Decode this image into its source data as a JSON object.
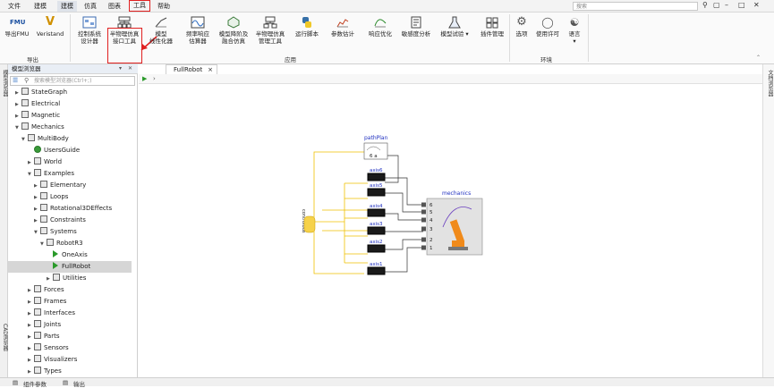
{
  "menubar": {
    "items": [
      "文件",
      "建模",
      "建模",
      "仿真",
      "图表",
      "工具",
      "帮助"
    ],
    "search_placeholder": "搜索"
  },
  "ribbon": {
    "export_fmu": "导出FMU",
    "veristand": "Veristand",
    "export_group": "导出",
    "ctrl_design": [
      "控制系统",
      "设计器"
    ],
    "hil_interface": [
      "半物理仿真",
      "接口工具"
    ],
    "model_linearizer": [
      "模型",
      "线性化器"
    ],
    "freq_estimator": [
      "频率响应",
      "估算器"
    ],
    "model_reduction": [
      "模型降阶及",
      "融合仿真"
    ],
    "hil_manager": [
      "半物理仿真",
      "管理工具"
    ],
    "run_script": "运行脚本",
    "param_estimation": "参数估计",
    "response_opt": "响应优化",
    "sensitivity": "敏感度分析",
    "model_test": "模型试验",
    "plugin_manager": "插件管理",
    "app_group": "应用",
    "options": "选项",
    "license": "使用许可",
    "language": "语言",
    "env_group": "环境"
  },
  "browser": {
    "title": "模型浏览器",
    "search_placeholder": "搜索模型浏览器(Ctrl+;)",
    "tree": [
      {
        "label": "StateGraph",
        "level": 1,
        "icon": "box"
      },
      {
        "label": "Electrical",
        "level": 1,
        "icon": "box"
      },
      {
        "label": "Magnetic",
        "level": 1,
        "icon": "box"
      },
      {
        "label": "Mechanics",
        "level": 1,
        "icon": "box",
        "open": true
      },
      {
        "label": "MultiBody",
        "level": 2,
        "icon": "box",
        "open": true
      },
      {
        "label": "UsersGuide",
        "level": 3,
        "icon": "green"
      },
      {
        "label": "World",
        "level": 3,
        "icon": "box"
      },
      {
        "label": "Examples",
        "level": 3,
        "icon": "box",
        "open": true
      },
      {
        "label": "Elementary",
        "level": 4,
        "icon": "box"
      },
      {
        "label": "Loops",
        "level": 4,
        "icon": "box"
      },
      {
        "label": "Rotational3DEffects",
        "level": 4,
        "icon": "box"
      },
      {
        "label": "Constraints",
        "level": 4,
        "icon": "box"
      },
      {
        "label": "Systems",
        "level": 4,
        "icon": "box",
        "open": true
      },
      {
        "label": "RobotR3",
        "level": 5,
        "icon": "box",
        "open": true
      },
      {
        "label": "OneAxis",
        "level": 6,
        "icon": "play"
      },
      {
        "label": "FullRobot",
        "level": 6,
        "icon": "play",
        "selected": true
      },
      {
        "label": "Utilities",
        "level": 6,
        "icon": "box"
      },
      {
        "label": "Forces",
        "level": 3,
        "icon": "box"
      },
      {
        "label": "Frames",
        "level": 3,
        "icon": "box"
      },
      {
        "label": "Interfaces",
        "level": 3,
        "icon": "box"
      },
      {
        "label": "Joints",
        "level": 3,
        "icon": "box"
      },
      {
        "label": "Parts",
        "level": 3,
        "icon": "box"
      },
      {
        "label": "Sensors",
        "level": 3,
        "icon": "box"
      },
      {
        "label": "Visualizers",
        "level": 3,
        "icon": "box"
      },
      {
        "label": "Types",
        "level": 3,
        "icon": "box"
      }
    ]
  },
  "left_strip": {
    "model_browser": "模型浏览器",
    "cad_browser": "CAD浏览器"
  },
  "right_strip": {
    "doc_browser": "文档浏览器"
  },
  "tab": {
    "label": "FullRobot",
    "close": "×"
  },
  "bottom": {
    "component_params": "组件参数",
    "output": "输出"
  },
  "diagram": {
    "pathplan_label": "pathPlan",
    "pathplan_value": "6 a",
    "controlbus_label": "controlBus",
    "mechanics_label": "mechanics",
    "axes": [
      "axis6",
      "axis5",
      "axis4",
      "axis3",
      "axis2",
      "axis1"
    ],
    "ports": [
      "6",
      "5",
      "4",
      "3",
      "2",
      "1"
    ]
  },
  "colors": {
    "accent_red": "#e02020",
    "bus_yellow": "#f0c000"
  }
}
